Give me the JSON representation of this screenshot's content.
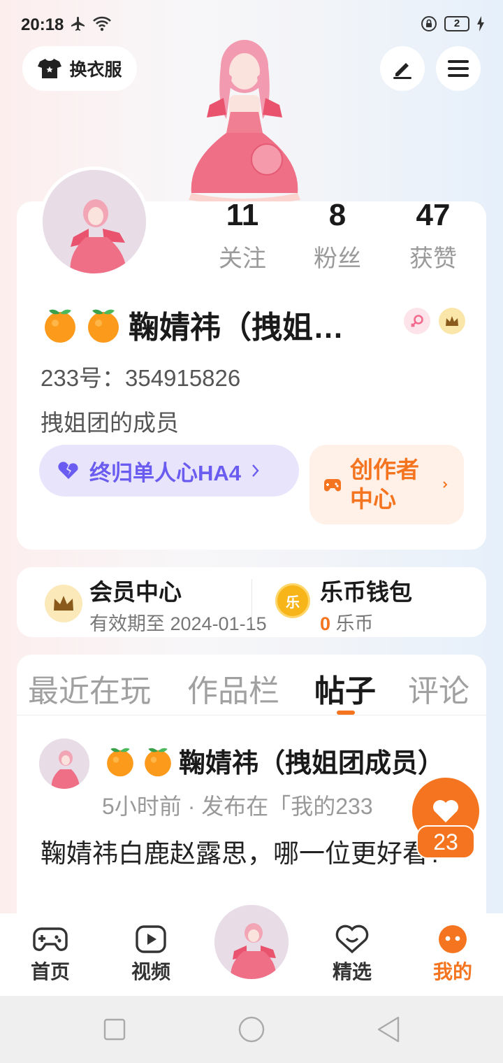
{
  "status_bar": {
    "time": "20:18",
    "battery": "2"
  },
  "top": {
    "outfit_label": "换衣服"
  },
  "profile": {
    "stats": [
      {
        "value": "11",
        "label": "关注"
      },
      {
        "value": "8",
        "label": "粉丝"
      },
      {
        "value": "47",
        "label": "获赞"
      }
    ],
    "username": "鞠婧祎（拽姐…",
    "id_line": "233号：354915826",
    "bio": "拽姐团的成员",
    "purple_pill": "终归单人心HA4",
    "creator_label": "创作者中心"
  },
  "vip": {
    "title": "会员中心",
    "subtitle": "有效期至 2024-01-15"
  },
  "wallet": {
    "title": "乐币钱包",
    "amount": "0",
    "unit": "乐币",
    "coin_glyph": "乐"
  },
  "tabs": [
    {
      "label": "最近在玩",
      "active": false
    },
    {
      "label": "作品栏",
      "active": false
    },
    {
      "label": "帖子",
      "active": true
    },
    {
      "label": "评论",
      "active": false
    }
  ],
  "post": {
    "author": "鞠婧祎（拽姐团成员）",
    "meta": "5小时前 · 发布在「我的233",
    "text": "鞠婧祎白鹿赵露思，哪一位更好看?",
    "likes": "23"
  },
  "bottom_nav": [
    {
      "label": "首页",
      "icon": "gamepad-icon",
      "active": false
    },
    {
      "label": "视频",
      "icon": "video-icon",
      "active": false
    },
    {
      "label": "精选",
      "icon": "heart-chat-icon",
      "active": false
    },
    {
      "label": "我的",
      "icon": "face-icon",
      "active": true
    }
  ],
  "colors": {
    "accent": "#f4741f",
    "purple": "#6a5cf0",
    "background_card": "#ffffff"
  }
}
